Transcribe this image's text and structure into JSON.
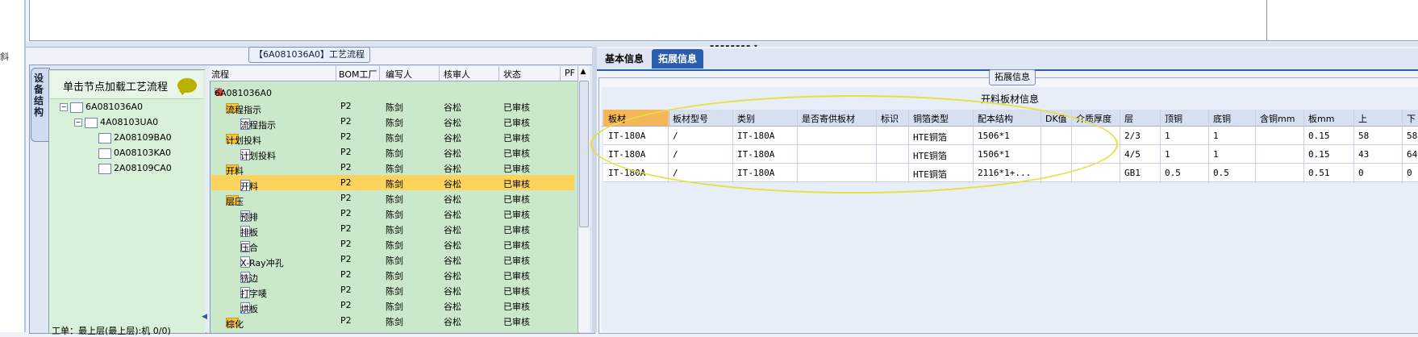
{
  "left_mark": "斜",
  "left_panel": {
    "title": "【6A081036A0】工艺流程",
    "vertical_tab": "设备结构",
    "tree_header": "单击节点加载工艺流程",
    "tree_nodes": [
      "6A081036A0",
      "4A08103UA0",
      "2A08109BA0",
      "0A08103KA0",
      "2A08109CA0"
    ],
    "tree_bottom": "工单：最上层(最上层):机 0/0)"
  },
  "process_grid": {
    "columns": [
      "流程",
      "BOM工厂",
      "编写人",
      "核审人",
      "状态",
      "PF"
    ],
    "rows": [
      {
        "name": "6A081036A0",
        "bom": "",
        "writer": "",
        "checker": "",
        "status": "",
        "kind": "root"
      },
      {
        "name": "流程指示",
        "bom": "P2",
        "writer": "陈剑",
        "checker": "谷松",
        "status": "已审核",
        "kind": "folder"
      },
      {
        "name": "流程指示",
        "bom": "P2",
        "writer": "陈剑",
        "checker": "谷松",
        "status": "已审核",
        "kind": "doc"
      },
      {
        "name": "计划投料",
        "bom": "P2",
        "writer": "陈剑",
        "checker": "谷松",
        "status": "已审核",
        "kind": "folder"
      },
      {
        "name": "计划投料",
        "bom": "P2",
        "writer": "陈剑",
        "checker": "谷松",
        "status": "已审核",
        "kind": "doc"
      },
      {
        "name": "开料",
        "bom": "P2",
        "writer": "陈剑",
        "checker": "谷松",
        "status": "已审核",
        "kind": "folder"
      },
      {
        "name": "开料",
        "bom": "P2",
        "writer": "陈剑",
        "checker": "谷松",
        "status": "已审核",
        "kind": "doc"
      },
      {
        "name": "层压",
        "bom": "P2",
        "writer": "陈剑",
        "checker": "谷松",
        "status": "已审核",
        "kind": "folder"
      },
      {
        "name": "预排",
        "bom": "P2",
        "writer": "陈剑",
        "checker": "谷松",
        "status": "已审核",
        "kind": "doc"
      },
      {
        "name": "排板",
        "bom": "P2",
        "writer": "陈剑",
        "checker": "谷松",
        "status": "已审核",
        "kind": "doc"
      },
      {
        "name": "压合",
        "bom": "P2",
        "writer": "陈剑",
        "checker": "谷松",
        "status": "已审核",
        "kind": "doc"
      },
      {
        "name": "X-Ray冲孔",
        "bom": "P2",
        "writer": "陈剑",
        "checker": "谷松",
        "status": "已审核",
        "kind": "doc"
      },
      {
        "name": "铣边",
        "bom": "P2",
        "writer": "陈剑",
        "checker": "谷松",
        "status": "已审核",
        "kind": "doc"
      },
      {
        "name": "打字唛",
        "bom": "P2",
        "writer": "陈剑",
        "checker": "谷松",
        "status": "已审核",
        "kind": "doc"
      },
      {
        "name": "烘板",
        "bom": "P2",
        "writer": "陈剑",
        "checker": "谷松",
        "status": "已审核",
        "kind": "doc"
      },
      {
        "name": "棕化",
        "bom": "P2",
        "writer": "陈剑",
        "checker": "谷松",
        "status": "已审核",
        "kind": "folder"
      }
    ]
  },
  "right_panel": {
    "tabs": [
      "基本信息",
      "拓展信息"
    ],
    "group_label": "拓展信息",
    "table_title": "开料板材信息",
    "columns": [
      "板材",
      "板材型号",
      "类别",
      "是否寄供板材",
      "标识",
      "铜箔类型",
      "配本结构",
      "DK值",
      "介质厚度",
      "层",
      "顶铜",
      "底铜",
      "含铜mm",
      "板mm",
      "上",
      "下"
    ],
    "rows": [
      [
        "IT-180A",
        "/",
        "IT-180A",
        "",
        "",
        "HTE铜箔",
        "1506*1",
        "",
        "",
        "2/3",
        "1",
        "1",
        "",
        "0.15",
        "58",
        "58"
      ],
      [
        "IT-180A",
        "/",
        "IT-180A",
        "",
        "",
        "HTE铜箔",
        "1506*1",
        "",
        "",
        "4/5",
        "1",
        "1",
        "",
        "0.15",
        "43",
        "64"
      ],
      [
        "IT-180A",
        "/",
        "IT-180A",
        "",
        "",
        "HTE铜箔",
        "2116*1+...",
        "",
        "",
        "GB1",
        "0.5",
        "0.5",
        "",
        "0.51",
        "0",
        "0"
      ]
    ]
  }
}
